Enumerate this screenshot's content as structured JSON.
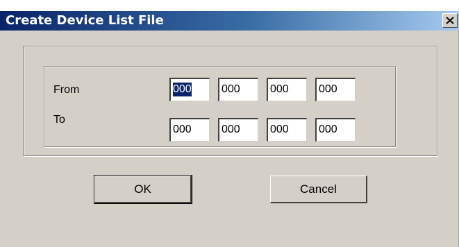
{
  "window": {
    "title": "Create Device List File",
    "close_glyph": "✕"
  },
  "range": {
    "from_label": "From",
    "to_label": "To",
    "from_octets": [
      "000",
      "000",
      "000",
      "000"
    ],
    "to_octets": [
      "000",
      "000",
      "000",
      "000"
    ]
  },
  "buttons": {
    "ok_label": "OK",
    "cancel_label": "Cancel"
  },
  "colors": {
    "titlebar_start": "#0a246a",
    "titlebar_end": "#a6caf0",
    "face": "#d4d0c8",
    "selection": "#0a246a"
  }
}
